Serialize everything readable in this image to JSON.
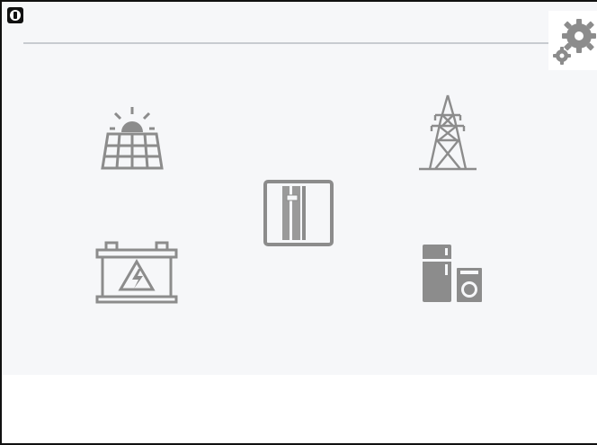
{
  "colors": {
    "icon": "#8c8c8c",
    "icon_dark": "#7a7a7a",
    "rule": "#c8cbd0",
    "background": "#f6f7f9",
    "frame": "#111111"
  },
  "icons": {
    "status": "status-indicator-icon",
    "settings": "gears-icon",
    "solar": "solar-panel-icon",
    "grid": "power-tower-icon",
    "inverter": "inverter-icon",
    "battery": "battery-icon",
    "loads": "household-appliances-icon"
  }
}
